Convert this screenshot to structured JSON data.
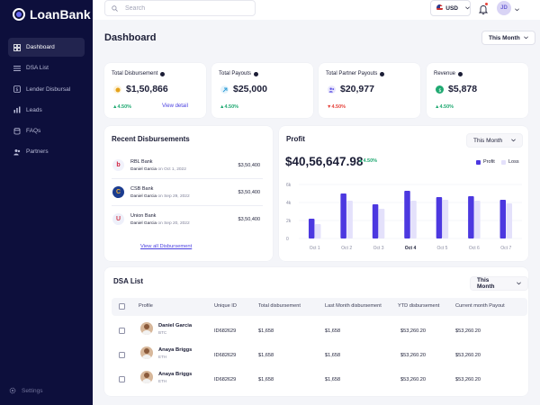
{
  "app": {
    "name": "LoanBank"
  },
  "sidebar": {
    "items": [
      {
        "label": "Dashboard",
        "icon": "grid-icon",
        "active": true
      },
      {
        "label": "DSA List",
        "icon": "list-icon"
      },
      {
        "label": "Lender Disbursal",
        "icon": "dollar-icon"
      },
      {
        "label": "Leads",
        "icon": "chart-icon"
      },
      {
        "label": "FAQs",
        "icon": "database-icon"
      },
      {
        "label": "Partners",
        "icon": "users-icon"
      }
    ],
    "settings_label": "Settings"
  },
  "topbar": {
    "search_placeholder": "Search",
    "currency": "USD",
    "avatar_initials": "JD"
  },
  "page": {
    "title": "Dashboard",
    "period": "This Month"
  },
  "stats": [
    {
      "label": "Total Disbursement",
      "value": "$1,50,866",
      "change": "4.50%",
      "direction": "up",
      "link": "View detail",
      "icon": "coin-icon",
      "icon_bg": "#fdf2d9",
      "icon_color": "#e5a21a"
    },
    {
      "label": "Total Payouts",
      "value": "$25,000",
      "change": "4.50%",
      "direction": "up",
      "icon": "arrow-up-right-icon",
      "icon_bg": "#e4f3fb",
      "icon_color": "#2c9bd6"
    },
    {
      "label": "Total Partner Payouts",
      "value": "$20,977",
      "change": "4.50%",
      "direction": "down",
      "icon": "users-icon",
      "icon_bg": "#e9e7fc",
      "icon_color": "#5a4fe3"
    },
    {
      "label": "Revenue",
      "value": "$5,878",
      "change": "4.50%",
      "direction": "up",
      "icon": "dollar-icon",
      "icon_bg": "#1fa971",
      "icon_color": "#ffffff"
    }
  ],
  "recent": {
    "title": "Recent Disbursements",
    "items": [
      {
        "bank": "RBL Bank",
        "person": "Daniel Garcia",
        "date": "on Oct 1, 2022",
        "amount": "$3,50,400",
        "logo": "b",
        "logo_bg": "#f1f2fb",
        "logo_color": "#d21f3c"
      },
      {
        "bank": "CSB Bank",
        "person": "Daniel Garcia",
        "date": "on Sep 29, 2022",
        "amount": "$3,50,400",
        "logo": "C",
        "logo_bg": "#1b3c8f",
        "logo_color": "#f2b233"
      },
      {
        "bank": "Union Bank",
        "person": "Daniel Garcia",
        "date": "on Sep 20, 2022",
        "amount": "$3,50,400",
        "logo": "U",
        "logo_bg": "#eef0fa",
        "logo_color": "#d33b4c"
      }
    ],
    "view_all": "View all Disbursement"
  },
  "profit": {
    "title": "Profit",
    "period": "This Month",
    "value": "$40,56,647.98",
    "change": "4.50%",
    "legend_profit": "Profit",
    "legend_loss": "Loss"
  },
  "chart_data": {
    "type": "bar",
    "categories": [
      "Oct 1",
      "Oct 2",
      "Oct 3",
      "Oct 4",
      "Oct 5",
      "Oct 6",
      "Oct 7"
    ],
    "highlight_category": "Oct 4",
    "series": [
      {
        "name": "Profit",
        "color": "#4c38e0",
        "values": [
          2.2,
          5.0,
          3.8,
          5.3,
          4.6,
          4.7,
          4.3
        ]
      },
      {
        "name": "Loss",
        "color": "#e4e1fb",
        "values": [
          1.6,
          4.2,
          3.3,
          4.2,
          4.3,
          4.2,
          3.9
        ]
      }
    ],
    "yticks": [
      "0",
      "2k",
      "4k",
      "6k"
    ],
    "ylim": [
      0,
      6
    ],
    "grid": true,
    "legend": "top-right"
  },
  "dsa": {
    "title": "DSA List",
    "period": "This Month",
    "columns": [
      "Profile",
      "Unique ID",
      "Total disbursement",
      "Last Month disbursement",
      "YTD disbursement",
      "Current month Payout"
    ],
    "rows": [
      {
        "name": "Daniel Garcia",
        "sub": "BTC",
        "id": "ID682629",
        "total": "$1,658",
        "last": "$1,658",
        "ytd": "$53,260.20",
        "payout": "$53,260.20"
      },
      {
        "name": "Anaya Briggs",
        "sub": "ETH",
        "id": "ID682629",
        "total": "$1,658",
        "last": "$1,658",
        "ytd": "$53,260.20",
        "payout": "$53,260.20"
      },
      {
        "name": "Anaya Briggs",
        "sub": "ETH",
        "id": "ID682629",
        "total": "$1,658",
        "last": "$1,658",
        "ytd": "$53,260.20",
        "payout": "$53,260.20"
      }
    ]
  }
}
